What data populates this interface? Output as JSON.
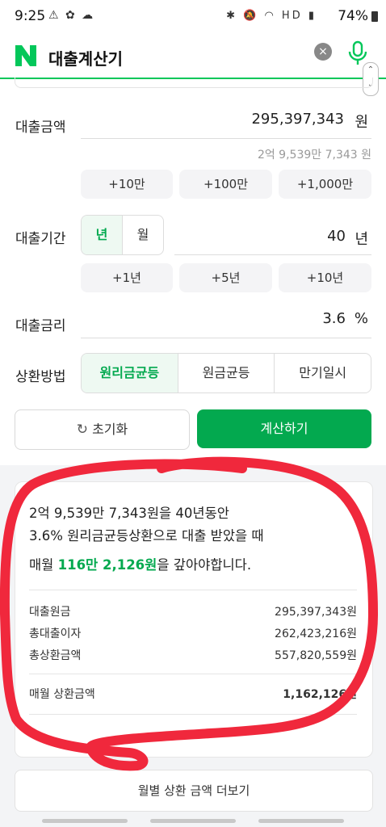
{
  "status_bar": {
    "time": "9:25",
    "left_icons": "⚠ ✿ ☁",
    "right_icons": "✱ 🔕 ◠ HD ▮",
    "battery": "74%"
  },
  "header": {
    "title": "대출계산기",
    "clear_icon": "×",
    "accent": "#03c75a"
  },
  "loan_amount": {
    "label": "대출금액",
    "value": "295,397,343",
    "unit": "원",
    "korean": "2억 9,539만 7,343 원",
    "buttons": [
      "+10만",
      "+100만",
      "+1,000만"
    ]
  },
  "loan_period": {
    "label": "대출기간",
    "unit_options": [
      "년",
      "월"
    ],
    "selected_unit": "년",
    "value": "40",
    "unit": "년",
    "buttons": [
      "+1년",
      "+5년",
      "+10년"
    ]
  },
  "interest_rate": {
    "label": "대출금리",
    "value": "3.6",
    "unit": "%"
  },
  "repayment": {
    "label": "상환방법",
    "options": [
      "원리금균등",
      "원금균등",
      "만기일시"
    ],
    "selected": "원리금균등"
  },
  "actions": {
    "reset": "초기화",
    "calculate": "계산하기"
  },
  "result": {
    "line1": "2억 9,539만 7,343원을 40년동안",
    "line2": "3.6% 원리금균등상환으로 대출 받았을 때",
    "monthly_prefix": "매월 ",
    "monthly_amount": "116만 2,126원",
    "monthly_suffix": "을 갚아야합니다.",
    "rows": [
      {
        "label": "대출원금",
        "value": "295,397,343원"
      },
      {
        "label": "총대출이자",
        "value": "262,423,216원"
      },
      {
        "label": "총상환금액",
        "value": "557,820,559원"
      }
    ],
    "monthly_row": {
      "label": "매월 상환금액",
      "value": "1,162,126원"
    }
  },
  "more_button": "월별 상환 금액 더보기",
  "colors": {
    "green": "#03a94f",
    "annotation_red": "#f0283c"
  }
}
